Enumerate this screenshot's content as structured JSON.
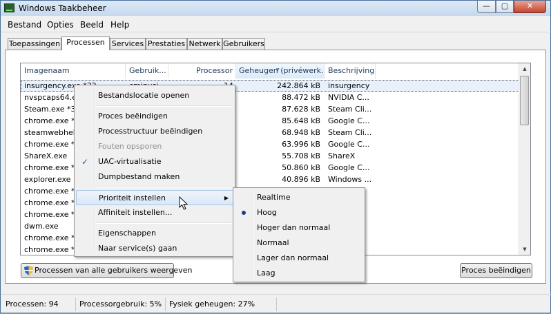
{
  "window": {
    "title": "Windows Taakbeheer",
    "controls": {
      "minimize": "—",
      "maximize": "▢",
      "close": "✕"
    }
  },
  "menu": [
    "Bestand",
    "Opties",
    "Beeld",
    "Help"
  ],
  "tabs": [
    "Toepassingen",
    "Processen",
    "Services",
    "Prestaties",
    "Netwerk",
    "Gebruikers"
  ],
  "active_tab": "Processen",
  "columns": {
    "name": "Imagenaam",
    "user": "Gebruik...",
    "cpu": "Processor",
    "memory": "Geheugen (privéwerk...",
    "desc": "Beschrijving"
  },
  "rows": [
    {
      "name": "insurgency.exe *32",
      "user": "cmjnusi",
      "cpu": "14",
      "memory": "242.864 kB",
      "desc": "insurgency"
    },
    {
      "name": "nvspcaps64.exe",
      "user": "",
      "cpu": "",
      "memory": "88.472 kB",
      "desc": "NVIDIA C..."
    },
    {
      "name": "Steam.exe *32",
      "user": "",
      "cpu": "",
      "memory": "87.628 kB",
      "desc": "Steam Cli..."
    },
    {
      "name": "chrome.exe *32",
      "user": "",
      "cpu": "",
      "memory": "85.648 kB",
      "desc": "Google C..."
    },
    {
      "name": "steamwebhelper",
      "user": "",
      "cpu": "",
      "memory": "68.948 kB",
      "desc": "Steam Cli..."
    },
    {
      "name": "chrome.exe *32",
      "user": "",
      "cpu": "",
      "memory": "63.996 kB",
      "desc": "Google C..."
    },
    {
      "name": "ShareX.exe",
      "user": "",
      "cpu": "",
      "memory": "55.708 kB",
      "desc": "ShareX"
    },
    {
      "name": "chrome.exe *32",
      "user": "",
      "cpu": "",
      "memory": "50.860 kB",
      "desc": "Google C..."
    },
    {
      "name": "explorer.exe",
      "user": "",
      "cpu": "",
      "memory": "40.896 kB",
      "desc": "Windows ..."
    },
    {
      "name": "chrome.exe *32",
      "user": "",
      "cpu": "",
      "memory": "",
      "desc": ""
    },
    {
      "name": "chrome.exe *32",
      "user": "",
      "cpu": "",
      "memory": "",
      "desc": ""
    },
    {
      "name": "chrome.exe *32",
      "user": "",
      "cpu": "",
      "memory": "",
      "desc": ""
    },
    {
      "name": "dwm.exe",
      "user": "",
      "cpu": "",
      "memory": "",
      "desc": ""
    },
    {
      "name": "chrome.exe *32",
      "user": "",
      "cpu": "",
      "memory": "",
      "desc": ""
    },
    {
      "name": "chrome.exe *32",
      "user": "",
      "cpu": "",
      "memory": "",
      "desc": ""
    }
  ],
  "context_menu": {
    "items": [
      {
        "label": "Bestandslocatie openen"
      },
      {
        "label": "Proces beëindigen"
      },
      {
        "label": "Processtructuur beëindigen"
      },
      {
        "label": "Fouten opsporen",
        "disabled": true
      },
      {
        "label": "UAC-virtualisatie",
        "checked": true
      },
      {
        "label": "Dumpbestand maken"
      },
      {
        "label": "Prioriteit instellen",
        "submenu": true,
        "highlighted": true
      },
      {
        "label": "Affiniteit instellen..."
      },
      {
        "label": "Eigenschappen"
      },
      {
        "label": "Naar service(s) gaan"
      }
    ],
    "check_glyph": "✓",
    "arrow_glyph": "▶"
  },
  "priority_submenu": {
    "items": [
      "Realtime",
      "Hoog",
      "Hoger dan normaal",
      "Normaal",
      "Lager dan normaal",
      "Laag"
    ],
    "selected": "Hoog"
  },
  "buttons": {
    "show_all": "Processen van alle gebruikers weergeven",
    "end_process": "Proces beëindigen"
  },
  "status": {
    "processes": "Processen: 94",
    "cpu": "Processorgebruik: 5%",
    "memory": "Fysiek geheugen: 27%"
  },
  "icons": {
    "scroll_up": "▲",
    "scroll_down": "▼",
    "sort_indicator": "▼"
  },
  "colors": {
    "selection": "#e8f1fb",
    "highlight_border": "#a8c6ea",
    "title_gradient": "#c5d9ee"
  }
}
